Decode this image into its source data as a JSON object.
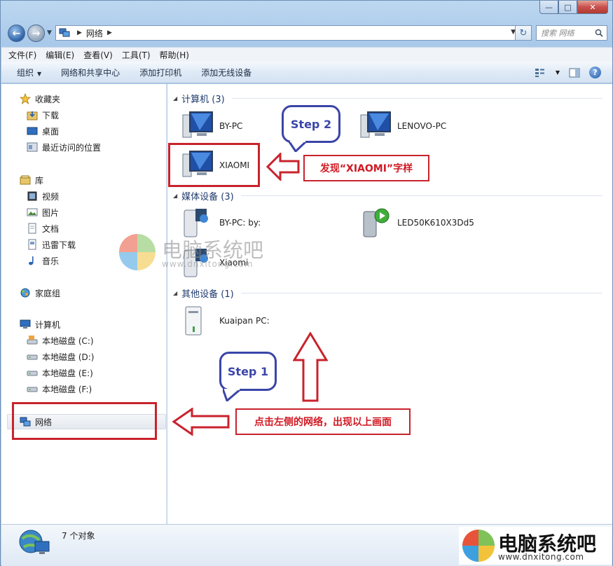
{
  "address": {
    "location": "网络"
  },
  "search": {
    "placeholder": "搜索 网络"
  },
  "menu": [
    "文件(F)",
    "编辑(E)",
    "查看(V)",
    "工具(T)",
    "帮助(H)"
  ],
  "commands": {
    "organize": "组织",
    "network_center": "网络和共享中心",
    "add_printer": "添加打印机",
    "add_wireless": "添加无线设备"
  },
  "sidebar": {
    "favorites": "收藏夹",
    "downloads": "下载",
    "desktop": "桌面",
    "recent": "最近访问的位置",
    "libraries": "库",
    "videos": "视频",
    "pictures": "图片",
    "documents": "文档",
    "xunlei": "迅雷下载",
    "music": "音乐",
    "homegroup": "家庭组",
    "computer": "计算机",
    "drive_c": "本地磁盘 (C:)",
    "drive_d": "本地磁盘 (D:)",
    "drive_e": "本地磁盘 (E:)",
    "drive_f": "本地磁盘 (F:)",
    "network": "网络"
  },
  "groups": {
    "computers": {
      "header": "计算机 (3)",
      "items": [
        "BY-PC",
        "LENOVO-PC",
        "XIAOMI"
      ]
    },
    "media": {
      "header": "媒体设备 (3)",
      "items": [
        "BY-PC: by:",
        "LED50K610X3Dd5",
        "Xiaomi"
      ]
    },
    "other": {
      "header": "其他设备 (1)",
      "items": [
        "Kuaipan PC:"
      ]
    }
  },
  "status": {
    "count": "7 个对象"
  },
  "annotations": {
    "step1": "Step 1",
    "step2": "Step 2",
    "found_text": "发现“XIAOMI”字样",
    "click_text": "点击左侧的网络，出现以上画面"
  },
  "watermark": {
    "name": "电脑系统吧",
    "url": "www.dnxitong.com"
  },
  "colors": {
    "accent_red": "#c8232c",
    "bubble_blue": "#3a45a8",
    "link_blue": "#1e3a6e"
  }
}
